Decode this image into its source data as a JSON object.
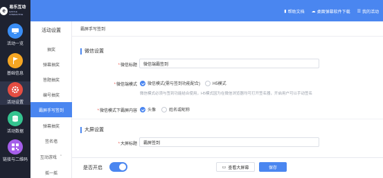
{
  "logo": {
    "mark": "e",
    "name": "易乐互动",
    "sub": "EASYLE INTERACTIVE"
  },
  "nav": [
    {
      "label": "活动一览",
      "icon": "monitor-icon",
      "color": "#3a8ef6"
    },
    {
      "label": "基础信息",
      "icon": "flag-icon",
      "color": "#f5a623"
    },
    {
      "label": "活动设置",
      "icon": "gear-icon",
      "color": "#e54d42",
      "active": true
    },
    {
      "label": "活动数据",
      "icon": "data-icon",
      "color": "#34c38f"
    },
    {
      "label": "链接与二维码",
      "icon": "qrcode-icon",
      "color": "#a55eea"
    }
  ],
  "toplinks": {
    "help": "帮助文档",
    "download": "桌面弹幕软件下载",
    "account": "我的活动"
  },
  "submenu": {
    "title": "活动设置",
    "items": [
      "抽奖",
      "弹幕抽奖",
      "答题抽奖",
      "编号抽奖",
      "霸屏手写签到",
      "弹幕抽奖",
      "签名墙",
      "互动游戏",
      "摇一摇"
    ],
    "active_index": 4
  },
  "crumb": "霸屏手写签到",
  "sections": {
    "wechat": "微信设置",
    "screen": "大屏设置"
  },
  "form": {
    "wechat_title_label": "微信标题",
    "wechat_title_value": "微信端霸签到",
    "mode_label": "微信端模式",
    "mode_options": [
      "微信模式(需与签到功能配合)",
      "H5模式"
    ],
    "mode_hint": "微信模式必须与签到功能结合使用，H5模式因为在微信浏览器均可打开签名器，开启用户可以手动签名",
    "content_label": "微信模式下霸屏内容",
    "content_options": [
      "头像",
      "姓名或昵称"
    ],
    "screen_title_label": "大屏标题",
    "screen_title_value": "霸屏签到"
  },
  "bottom": {
    "toggle_label": "是否开启",
    "preview_label": "查看大屏幕",
    "save_label": "保存"
  }
}
